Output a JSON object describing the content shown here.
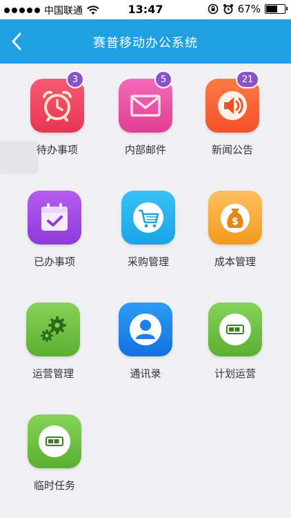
{
  "status_bar": {
    "carrier": "中国联通",
    "time": "13:47",
    "battery": "67%",
    "battery_level": 0.67
  },
  "navbar": {
    "title": "赛普移动办公系统",
    "back_icon": "chevron-left-icon"
  },
  "apps": [
    {
      "id": "todo",
      "label": "待办事项",
      "icon": "alarm-clock-icon",
      "badge": "3",
      "color_top": "#f75a73",
      "color_bottom": "#e73556"
    },
    {
      "id": "mail",
      "label": "内部邮件",
      "icon": "envelope-icon",
      "badge": "5",
      "color_top": "#f56ab9",
      "color_bottom": "#e13e92"
    },
    {
      "id": "news",
      "label": "新闻公告",
      "icon": "speaker-icon",
      "badge": "21",
      "color_top": "#ff7a45",
      "color_bottom": "#f3502a"
    },
    {
      "id": "done",
      "label": "已办事项",
      "icon": "calendar-check-icon",
      "badge": "",
      "color_top": "#b65df0",
      "color_bottom": "#8c3bd9"
    },
    {
      "id": "purchase",
      "label": "采购管理",
      "icon": "shopping-cart-icon",
      "badge": "",
      "color_top": "#37c2f7",
      "color_bottom": "#1ba3e6"
    },
    {
      "id": "cost",
      "label": "成本管理",
      "icon": "money-bag-icon",
      "badge": "",
      "color_top": "#ffc060",
      "color_bottom": "#f39a1c"
    },
    {
      "id": "ops",
      "label": "运营管理",
      "icon": "gears-icon",
      "badge": "",
      "color_top": "#86d35a",
      "color_bottom": "#5aaf31"
    },
    {
      "id": "contacts",
      "label": "通讯录",
      "icon": "contact-person-icon",
      "badge": "",
      "color_top": "#2d9cf6",
      "color_bottom": "#1272df"
    },
    {
      "id": "plan",
      "label": "计划运营",
      "icon": "progress-bar-icon",
      "badge": "",
      "color_top": "#86d35a",
      "color_bottom": "#5aaf31"
    },
    {
      "id": "temp",
      "label": "临时任务",
      "icon": "progress-bar-icon",
      "badge": "",
      "color_top": "#86d35a",
      "color_bottom": "#5aaf31"
    }
  ]
}
